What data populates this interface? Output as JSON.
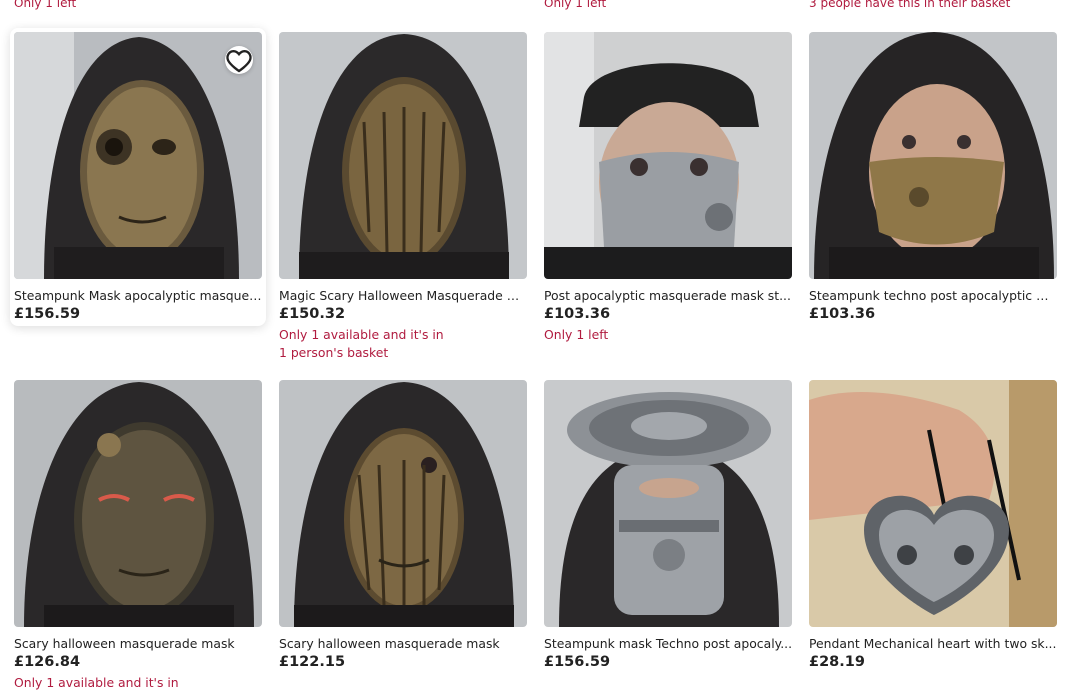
{
  "top_notes": [
    "Only 1 left",
    "Only 1 left",
    "3 people have this in their basket"
  ],
  "listings": [
    {
      "title": "Steampunk Mask apocalyptic masquer...",
      "price": "£156.59",
      "note": "",
      "image": "hooded person wearing bronze half-cyborg steampunk mask",
      "favorite_icon": "heart-outline-icon"
    },
    {
      "title": "Magic Scary Halloween Masquerade Bl...",
      "price": "£150.32",
      "note": "Only 1 available and it's in 1 person's basket",
      "image": "hooded person wearing bark-textured gold full-face mask"
    },
    {
      "title": "Post apocalyptic masquerade mask st...",
      "price": "£103.36",
      "note": "Only 1 left",
      "image": "person in black cap wearing silver mechanical half mask"
    },
    {
      "title": "Steampunk techno post apocalyptic m...",
      "price": "£103.36",
      "note": "",
      "image": "hooded person wearing gold mechanical lower-face mask"
    },
    {
      "title": "Scary halloween masquerade mask",
      "price": "£126.84",
      "note": "Only 1 available and it's in",
      "image": "hooded person wearing dark root-textured mask with red eyes"
    },
    {
      "title": "Scary halloween masquerade mask",
      "price": "£122.15",
      "note": "",
      "image": "hooded person wearing bark-textured mask"
    },
    {
      "title": "Steampunk mask Techno post apocaly...",
      "price": "£156.59",
      "note": "",
      "image": "hooded person wearing silver steampunk helmet with disc top"
    },
    {
      "title": "Pendant Mechanical heart with two sk...",
      "price": "£28.19",
      "note": "",
      "image": "hand holding silver mechanical heart pendant on cord"
    }
  ]
}
